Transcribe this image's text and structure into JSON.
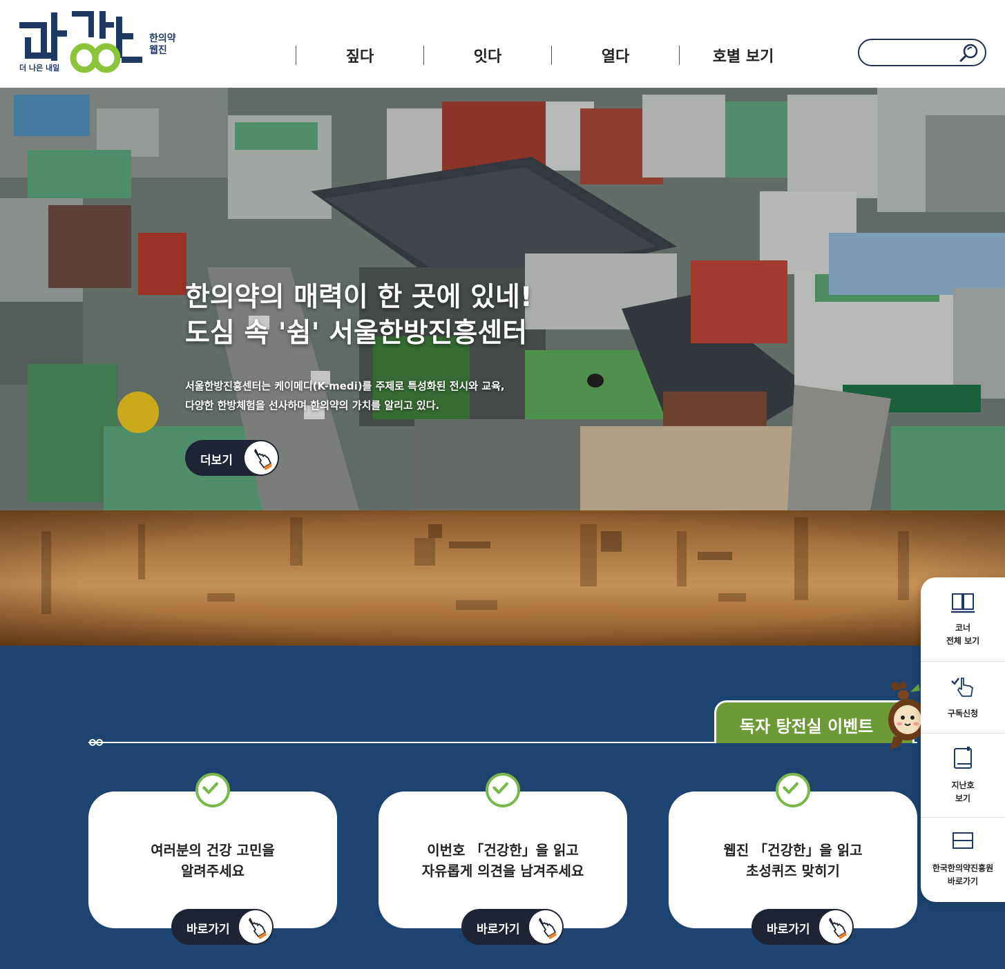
{
  "header": {
    "logo_main": "건강한",
    "logo_sub_line1": "한의약",
    "logo_sub_line2": "웹진",
    "logo_tagline": "더 나은 내일",
    "nav": [
      "짚다",
      "잇다",
      "열다",
      "호별 보기"
    ],
    "search_placeholder": ""
  },
  "hero": {
    "title_line1": "한의약의 매력이 한 곳에 있네!",
    "title_line2": "도심 속 '쉼' 서울한방진흥센터",
    "desc_line1": "서울한방진흥센터는 케이메디(K-medi)를 주제로 특성화된 전시와 교육,",
    "desc_line2": "다양한 한방체험을 선사하며 한의약의 가치를 알리고 있다.",
    "more_label": "더보기"
  },
  "event": {
    "tab_label": "독자 탕전실 이벤트",
    "cards": [
      {
        "line1": "여러분의 건강 고민을",
        "line2": "알려주세요",
        "button": "바로가기"
      },
      {
        "line1": "이번호 「건강한」을 읽고",
        "line2": "자유롭게 의견을 남겨주세요",
        "button": "바로가기"
      },
      {
        "line1": "웹진 「건강한」을 읽고",
        "line2": "초성퀴즈 맞히기",
        "button": "바로가기"
      }
    ]
  },
  "side_menu": [
    {
      "label": "코너\n전체 보기",
      "icon": "book-open-icon"
    },
    {
      "label": "구독신청",
      "icon": "hand-check-icon"
    },
    {
      "label": "지난호\n보기",
      "icon": "book-icon"
    },
    {
      "label": "한국한의약진흥원\n바로가기",
      "icon": "frame-icon"
    }
  ],
  "colors": {
    "navy": "#1d4370",
    "green": "#6d9a36",
    "check_green": "#7ab648",
    "dark_btn": "#1e2433"
  }
}
